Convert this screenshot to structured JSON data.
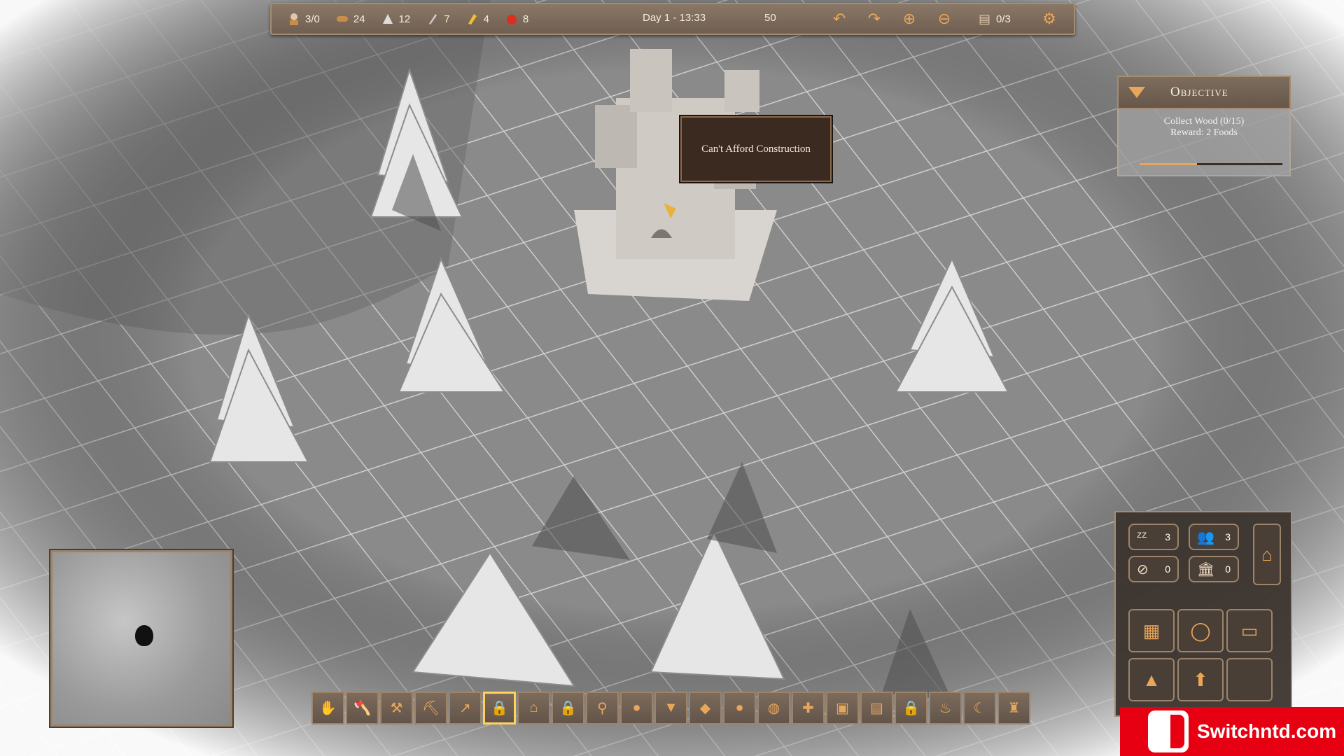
{
  "topbar": {
    "resources": [
      {
        "icon": "villager-icon",
        "value": "3/0"
      },
      {
        "icon": "wood-icon",
        "value": "24"
      },
      {
        "icon": "stone-icon",
        "value": "12"
      },
      {
        "icon": "iron-icon",
        "value": "7"
      },
      {
        "icon": "gold-icon",
        "value": "4"
      },
      {
        "icon": "food-icon",
        "value": "8"
      }
    ],
    "day_time": "Day 1 - 13:33",
    "score": "50",
    "quota": "0/3"
  },
  "objective": {
    "title": "Objective",
    "line1": "Collect Wood (0/15)",
    "line2": "Reward: 2 Foods",
    "progress": 0.4
  },
  "tooltip": {
    "text": "Can't Afford Construction"
  },
  "stats": {
    "sleep": "3",
    "population": "3",
    "blocked": "0",
    "buildings": "0"
  },
  "toolbar": {
    "selected_index": 5,
    "tools": [
      "hand-icon",
      "axe-icon",
      "hammer-icon",
      "pickaxe-icon",
      "spear-icon",
      "lock-icon",
      "house-icon",
      "lock-icon",
      "hoe-icon",
      "apple-icon",
      "carrot-icon",
      "corn-icon",
      "pumpkin-icon",
      "melon-icon",
      "tool-icon",
      "chest-icon",
      "book-icon",
      "lock-icon",
      "torch-icon",
      "sickle-icon",
      "chair-icon"
    ]
  },
  "watermark": {
    "text": "Switchntd.com"
  },
  "colors": {
    "accent": "#e8a65a",
    "panel": "#7b6a5a",
    "alert": "#e60012"
  }
}
